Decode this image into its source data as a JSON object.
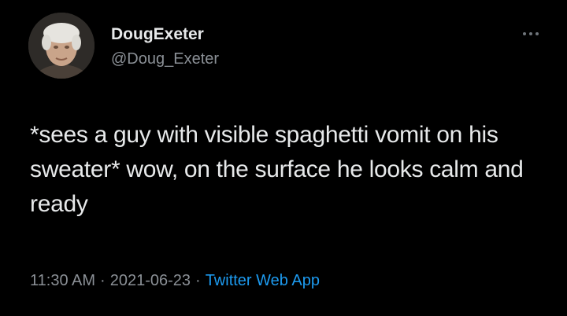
{
  "tweet": {
    "author": {
      "display_name": "DougExeter",
      "handle": "@Doug_Exeter",
      "avatar_icon": "profile-avatar"
    },
    "more_icon": "more-options-icon",
    "text": "*sees a guy with visible spaghetti vomit on his sweater* wow, on the surface he looks calm and ready",
    "time": "11:30 AM",
    "date": "2021-06-23",
    "separator": "·",
    "source": "Twitter Web App"
  },
  "colors": {
    "background": "#000000",
    "primary_text": "#e7e9ea",
    "secondary_text": "#8b9096",
    "link": "#1d9bf0"
  }
}
